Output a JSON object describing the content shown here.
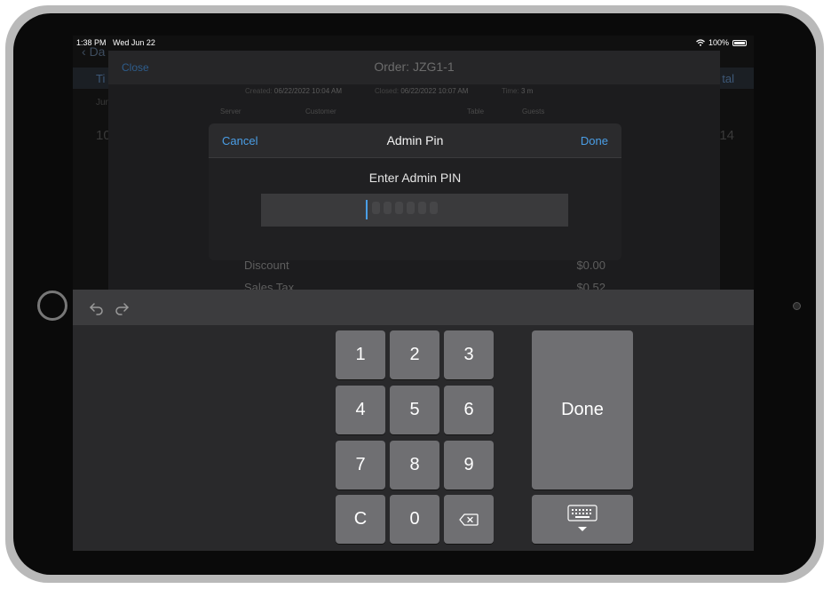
{
  "status_bar": {
    "time": "1:38 PM",
    "date": "Wed Jun 22",
    "battery": "100%"
  },
  "background": {
    "back_label": "Da",
    "col_left": "Ti",
    "col_right": "tal",
    "sub_left": "Jun",
    "row_left": "10",
    "row_right": "14"
  },
  "order": {
    "close_label": "Close",
    "title": "Order: JZG1-1",
    "created_label": "Created:",
    "created_value": "06/22/2022 10:04 AM",
    "closed_label": "Closed:",
    "closed_value": "06/22/2022 10:07 AM",
    "time_label": "Time:",
    "time_value": "3 m",
    "columns": [
      "Server",
      "Customer",
      "Table",
      "Guests"
    ],
    "totals": [
      {
        "label": "Discount",
        "value": "$0.00"
      },
      {
        "label": "Sales Tax",
        "value": "$0.52"
      }
    ]
  },
  "admin_pin": {
    "cancel_label": "Cancel",
    "title": "Admin Pin",
    "done_label": "Done",
    "prompt": "Enter Admin PIN",
    "value": ""
  },
  "keyboard": {
    "keys": [
      "1",
      "2",
      "3",
      "4",
      "5",
      "6",
      "7",
      "8",
      "9",
      "C",
      "0"
    ],
    "done_label": "Done",
    "icons": [
      "undo-icon",
      "redo-icon",
      "backspace-icon",
      "keyboard-dismiss-icon"
    ]
  }
}
